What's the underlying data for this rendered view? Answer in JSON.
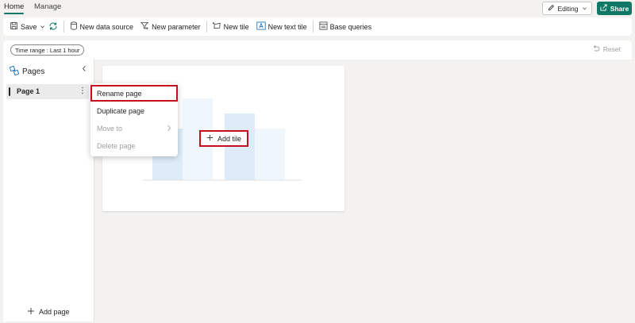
{
  "tabs": [
    {
      "label": "Home",
      "active": true
    },
    {
      "label": "Manage",
      "active": false
    }
  ],
  "header": {
    "editing_label": "Editing",
    "share_label": "Share"
  },
  "toolbar": {
    "save_label": "Save",
    "new_data_source_label": "New data source",
    "new_parameter_label": "New parameter",
    "new_tile_label": "New tile",
    "new_text_tile_label": "New text tile",
    "base_queries_label": "Base queries"
  },
  "filters": {
    "time_range_label": "Time range : Last 1 hour",
    "reset_label": "Reset"
  },
  "pages_panel": {
    "title": "Pages",
    "pages": [
      {
        "label": "Page 1",
        "selected": true
      }
    ],
    "add_page_label": "Add page"
  },
  "context_menu": {
    "items": [
      {
        "label": "Rename page",
        "disabled": false,
        "highlighted": true
      },
      {
        "label": "Duplicate page",
        "disabled": false,
        "highlighted": false
      },
      {
        "label": "Move to",
        "disabled": true,
        "highlighted": false
      },
      {
        "label": "Delete page",
        "disabled": true,
        "highlighted": false
      }
    ]
  },
  "canvas": {
    "add_tile_label": "Add tile"
  },
  "colors": {
    "accent": "#117865",
    "highlight_border": "#c50f1f",
    "placeholder_bar_dark": "#deecf9",
    "placeholder_bar_light": "#eff6fc"
  }
}
